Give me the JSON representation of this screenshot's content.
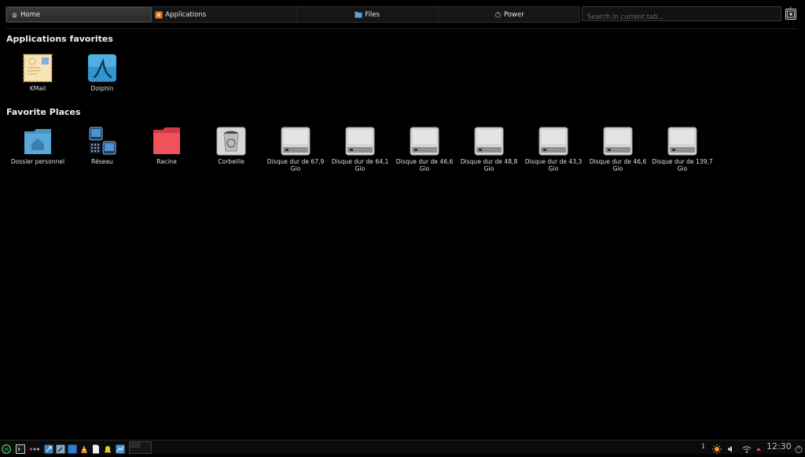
{
  "tabs": [
    {
      "label": "Home",
      "icon": "home-icon",
      "active": true
    },
    {
      "label": "Applications",
      "icon": "applications-icon"
    },
    {
      "label": "Files",
      "icon": "files-icon"
    },
    {
      "label": "Power",
      "icon": "power-icon"
    }
  ],
  "search": {
    "placeholder": "Search in current tab..."
  },
  "sections": {
    "apps_title": "Applications favorites",
    "places_title": "Favorite Places"
  },
  "apps": [
    {
      "label": "KMail",
      "icon": "kmail-icon"
    },
    {
      "label": "Dolphin",
      "icon": "dolphin-icon"
    }
  ],
  "places": [
    {
      "label": "Dossier personnel",
      "icon": "home-folder-icon"
    },
    {
      "label": "Réseau",
      "icon": "network-icon"
    },
    {
      "label": "Racine",
      "icon": "root-folder-icon"
    },
    {
      "label": "Corbeille",
      "icon": "trash-icon"
    },
    {
      "label": "Disque dur de 67,9 Gio",
      "icon": "hard-disk-icon"
    },
    {
      "label": "Disque dur de 64,1 Gio",
      "icon": "hard-disk-icon"
    },
    {
      "label": "Disque dur de 46,6 Gio",
      "icon": "hard-disk-icon"
    },
    {
      "label": "Disque dur de 48,8 Gio",
      "icon": "hard-disk-icon"
    },
    {
      "label": "Disque dur de 43,3 Gio",
      "icon": "hard-disk-icon"
    },
    {
      "label": "Disque dur de 46,6 Gio",
      "icon": "hard-disk-icon"
    },
    {
      "label": "Disque dur de 139,7 Gio",
      "icon": "hard-disk-icon"
    }
  ],
  "taskbar": {
    "desktop_number": "1",
    "clock": "12:30"
  },
  "colors": {
    "accent": "#3a9bd5",
    "folder_red": "#ee4c55"
  }
}
